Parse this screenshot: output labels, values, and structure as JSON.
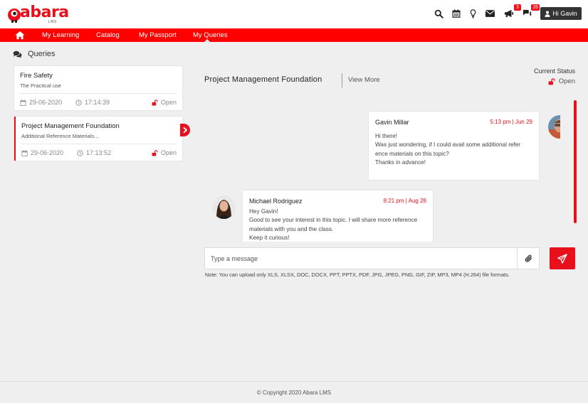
{
  "brand": {
    "name": "abara",
    "sub": "LMS",
    "color": "#e8101c"
  },
  "header": {
    "icons": [
      "search-icon",
      "calendar-icon",
      "lightbulb-icon",
      "envelope-icon",
      "megaphone-icon",
      "chat-icon"
    ],
    "announcements_badge": "3",
    "messages_badge": "26",
    "user_label": "Hi Gavin"
  },
  "nav": {
    "items": [
      {
        "label": "My Learning"
      },
      {
        "label": "Catalog"
      },
      {
        "label": "My Passport"
      },
      {
        "label": "My Queries"
      }
    ]
  },
  "page": {
    "title": "Queries"
  },
  "queries": [
    {
      "title": "Fire Safety",
      "subtitle": "The Practical use",
      "date": "29-06-2020",
      "time": "17:14:39",
      "status": "Open"
    },
    {
      "title": "Project Management Foundation",
      "subtitle": "Additional Reference Materials...",
      "date": "29-06-2020",
      "time": "17:13:52",
      "status": "Open"
    }
  ],
  "conversation": {
    "title": "Project Management Foundation",
    "view_more": "View More",
    "status_label": "Current Status",
    "status_value": "Open",
    "messages": [
      {
        "author": "Gavin Millar",
        "time": "5:13 pm | Jun 29",
        "lines": [
          "Hi there!",
          "Was just wondering, if I could avail some additional refer",
          "ence materials on this topic?",
          "Thanks in advance!"
        ]
      },
      {
        "author": "Michael Rodriguez",
        "time": "8:21 pm | Aug 28",
        "lines": [
          "Hey Gavin!",
          "Good to see your interest in this topic. I will share more reference",
          "materials with you and the class.",
          "Keep it curious!"
        ]
      }
    ]
  },
  "composer": {
    "placeholder": "Type a message",
    "note": "Note: You can upload only XLS, XLSX, DOC, DOCX, PPT, PPTX, PDF, JPG, JPEG, PNG, GIF, ZIP, MP3, MP4 (H.264) file formats."
  },
  "footer": {
    "copyright": "© Copyright 2020 Abara LMS"
  }
}
